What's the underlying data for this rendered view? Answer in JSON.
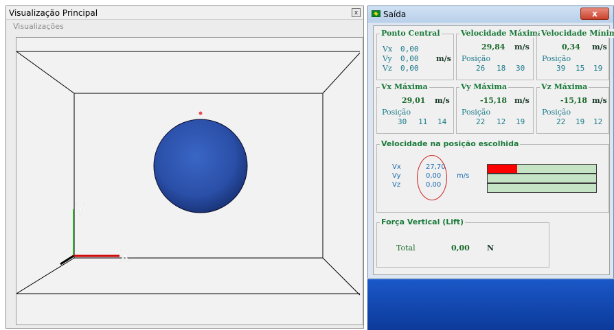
{
  "left_window": {
    "title": "Visualização Principal",
    "close": "x",
    "menu": "Visualizações"
  },
  "viewport": {
    "axis_x": "X",
    "axis_y": "Y"
  },
  "right_window": {
    "title": "Saída",
    "close": "x",
    "ponto_central": {
      "title": "Ponto Central",
      "rows": [
        {
          "label": "Vx",
          "value": "0,00"
        },
        {
          "label": "Vy",
          "value": "0,00"
        },
        {
          "label": "Vz",
          "value": "0,00"
        }
      ],
      "unit": "m/s"
    },
    "cards": [
      {
        "title": "Velocidade Máxima",
        "value": "29,84",
        "unit": "m/s",
        "pos_label": "Posição",
        "pos": [
          "26",
          "18",
          "30"
        ]
      },
      {
        "title": "Velocidade Mínima",
        "value": "0,34",
        "unit": "m/s",
        "pos_label": "Posição",
        "pos": [
          "39",
          "15",
          "19"
        ]
      },
      {
        "title": "Vx Máxima",
        "value": "29,01",
        "unit": "m/s",
        "pos_label": "Posição",
        "pos": [
          "30",
          "11",
          "14"
        ]
      },
      {
        "title": "Vy Máxima",
        "value": "-15,18",
        "unit": "m/s",
        "pos_label": "Posição",
        "pos": [
          "22",
          "12",
          "19"
        ]
      },
      {
        "title": "Vz Máxima",
        "value": "-15,18",
        "unit": "m/s",
        "pos_label": "Posição",
        "pos": [
          "22",
          "19",
          "12"
        ]
      }
    ],
    "selected": {
      "title": "Velocidade na posição escolhida",
      "labels": [
        "Vx",
        "Vy",
        "Vz"
      ],
      "values": [
        "27,70",
        "0,00",
        "0,00"
      ],
      "unit": "m/s",
      "bar_fraction": [
        0.27,
        0,
        0
      ],
      "bar_color": "#ff0000"
    },
    "lift": {
      "title": "Força Vertical (Lift)",
      "label": "Total",
      "value": "0,00",
      "unit": "N"
    }
  },
  "colors": {
    "sphere": "#2a4fa8",
    "axis_x": "#d00000",
    "axis_y": "#20b020",
    "green_text": "#1a7a3a"
  }
}
